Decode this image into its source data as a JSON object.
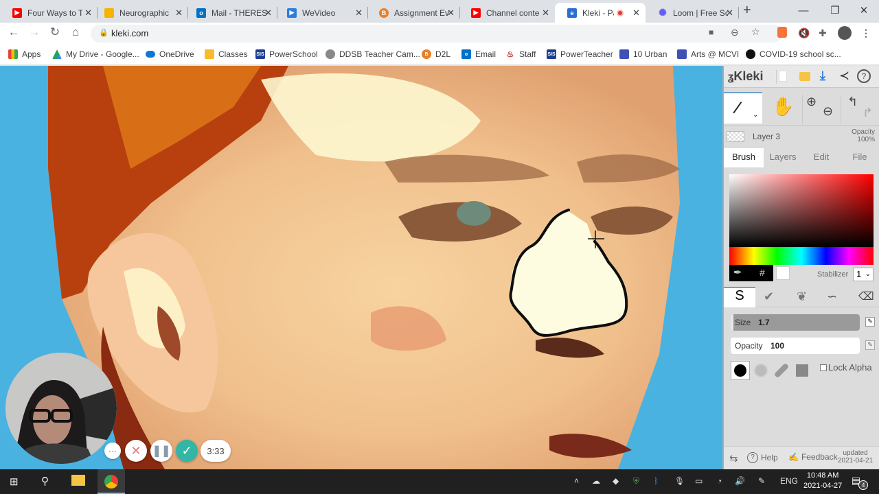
{
  "browser": {
    "tabs": [
      {
        "title": "Four Ways to T",
        "icon": "youtube-icon",
        "color": "#ff0000"
      },
      {
        "title": "Neurographic",
        "icon": "slides-icon",
        "color": "#f4b400"
      },
      {
        "title": "Mail - THERES",
        "icon": "outlook-icon",
        "color": "#0072c6"
      },
      {
        "title": "WeVideo",
        "icon": "wevideo-icon",
        "color": "#2d7de0"
      },
      {
        "title": "Assignment Ev",
        "icon": "brightspace-icon",
        "color": "#e8802a"
      },
      {
        "title": "Channel conte",
        "icon": "youtube-icon",
        "color": "#ff0000"
      },
      {
        "title": "Kleki - Pai",
        "icon": "kleki-icon",
        "color": "#2b6ed4",
        "active": true,
        "recording": true
      },
      {
        "title": "Loom | Free Sc",
        "icon": "loom-icon",
        "color": "#625df5"
      }
    ],
    "new_tab": "+",
    "window_controls": {
      "minimize": "—",
      "restore": "❐",
      "close": "✕"
    },
    "url": "kleki.com",
    "bookmarks": [
      {
        "label": "Apps",
        "icon": "apps-grid-icon",
        "color": "#e94235"
      },
      {
        "label": "My Drive - Google...",
        "icon": "google-drive-icon",
        "color": "#1fa463"
      },
      {
        "label": "OneDrive",
        "icon": "onedrive-icon",
        "color": "#0f78d4"
      },
      {
        "label": "Classes",
        "icon": "classroom-icon",
        "color": "#f9bb2d"
      },
      {
        "label": "PowerSchool",
        "icon": "sis-icon",
        "color": "#1c3f94"
      },
      {
        "label": "DDSB Teacher Cam...",
        "icon": "camera-icon",
        "color": "#666666"
      },
      {
        "label": "D2L",
        "icon": "brightspace-icon",
        "color": "#e8802a"
      },
      {
        "label": "Email",
        "icon": "outlook-icon",
        "color": "#0072c6"
      },
      {
        "label": "Staff",
        "icon": "flame-icon",
        "color": "#c0392b"
      },
      {
        "label": "PowerTeacher",
        "icon": "sis-icon",
        "color": "#1c3f94"
      },
      {
        "label": "10 Urban",
        "icon": "calendar-icon",
        "color": "#3f51b5"
      },
      {
        "label": "Arts @ MCVI",
        "icon": "calendar-icon",
        "color": "#3f51b5"
      },
      {
        "label": "COVID-19 school sc...",
        "icon": "ontario-icon",
        "color": "#111111"
      }
    ]
  },
  "kleki": {
    "logo": "Kleki",
    "layer_name": "Layer 3",
    "opacity_label": "Opacity",
    "opacity_value": "100%",
    "tabs": [
      "Brush",
      "Layers",
      "Edit",
      "File"
    ],
    "active_tab": "Brush",
    "hex_symbol": "#",
    "stabilizer_label": "Stabilizer",
    "stabilizer_value": "1",
    "size_label": "Size",
    "size_value": "1.7",
    "opacity_slider_label": "Opacity",
    "opacity_slider_value": "100",
    "lock_alpha": "Lock Alpha",
    "help": "Help",
    "feedback": "Feedback",
    "updated_label": "updated",
    "updated_date": "2021-04-21",
    "primary_color": "#000000",
    "secondary_color": "#ffffff"
  },
  "loom": {
    "timer": "3:33",
    "more": "···"
  },
  "taskbar": {
    "language": "ENG",
    "time": "10:48 AM",
    "date": "2021-04-27",
    "notifications": "4"
  }
}
